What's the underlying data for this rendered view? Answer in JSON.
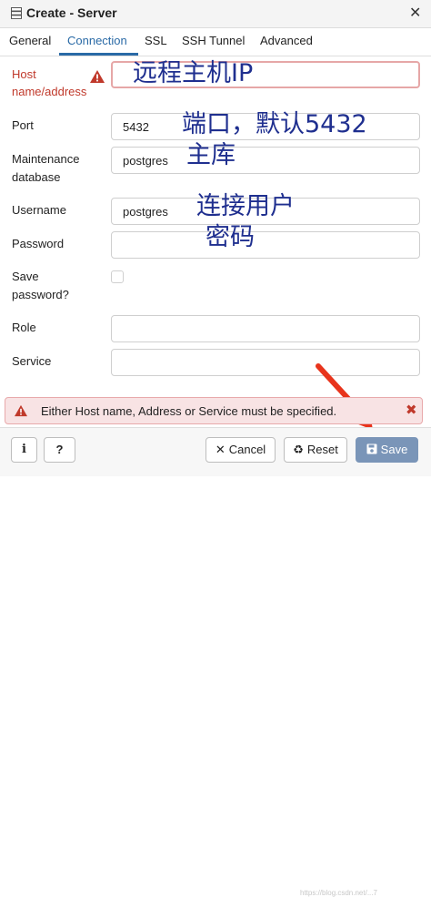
{
  "window": {
    "title": "Create - Server",
    "close_glyph": "✕"
  },
  "tabs": [
    {
      "label": "General"
    },
    {
      "label": "Connection",
      "active": true
    },
    {
      "label": "SSL"
    },
    {
      "label": "SSH Tunnel"
    },
    {
      "label": "Advanced"
    }
  ],
  "form": {
    "host_label_1": "Host",
    "host_label_2": "name/address",
    "host_value": "",
    "port_label": "Port",
    "port_value": "5432",
    "maint_label_1": "Maintenance",
    "maint_label_2": "database",
    "maint_value": "postgres",
    "username_label": "Username",
    "username_value": "postgres",
    "password_label": "Password",
    "password_value": "",
    "save_pw_label_1": "Save",
    "save_pw_label_2": "password?",
    "save_pw_checked": false,
    "role_label": "Role",
    "role_value": "",
    "service_label": "Service",
    "service_value": ""
  },
  "annotations": {
    "host": "远程主机IP",
    "port_line1": "端口，默认5432",
    "port_line2": "主库",
    "user_line1": "连接用户",
    "user_line2": "密码"
  },
  "alert": {
    "message": "Either Host name, Address or Service must be specified.",
    "close_glyph": "✖"
  },
  "footer": {
    "info_label": "i",
    "help_label": "?",
    "cancel_icon": "✕",
    "cancel_label": "Cancel",
    "reset_icon": "♻",
    "reset_label": "Reset",
    "save_label": "Save"
  },
  "colors": {
    "accent": "#2a6aa6",
    "error": "#c0392b",
    "annotation": "#1f2f8f",
    "arrow": "#e8341c",
    "save_button": "#7a95b8"
  },
  "watermark": "https://blog.csdn.net/...7"
}
